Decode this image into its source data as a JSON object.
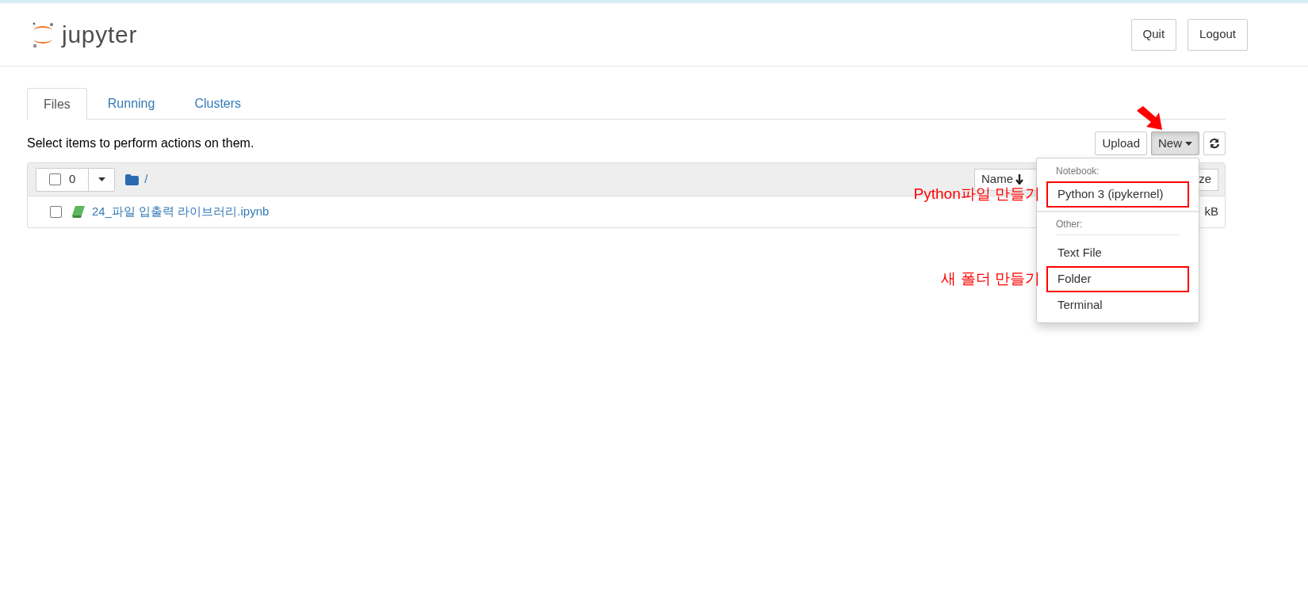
{
  "logo": {
    "text": "jupyter"
  },
  "header_buttons": [
    "Quit",
    "Logout"
  ],
  "tabs": [
    {
      "label": "Files",
      "selected": true
    },
    {
      "label": "Running",
      "selected": false
    },
    {
      "label": "Clusters",
      "selected": false
    }
  ],
  "instruction": "Select items to perform actions on them.",
  "toolbar": {
    "upload": "Upload",
    "new": "New",
    "new_open": true
  },
  "file_list": {
    "select_count": "0",
    "select_all_checked": false,
    "path": "/",
    "sort_button": "Name",
    "column_3": "ze",
    "rows": [
      {
        "name": "24_파일 입출력 라이브러리.ipynb",
        "size": "kB",
        "checked": false
      }
    ]
  },
  "new_menu": {
    "sections": [
      {
        "header": "Notebook:",
        "items": [
          {
            "label": "Python 3 (ipykernel)",
            "annotation": "Python파일 만들기"
          }
        ]
      },
      {
        "header": "Other:",
        "items": [
          {
            "label": "Text File"
          },
          {
            "label": "Folder",
            "annotation": "새 폴더 만들기"
          },
          {
            "label": "Terminal"
          }
        ]
      }
    ]
  }
}
